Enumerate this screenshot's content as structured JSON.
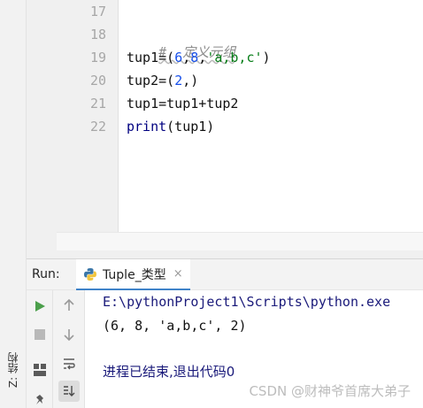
{
  "editor": {
    "line_numbers": [
      "17",
      "18",
      "19",
      "20",
      "21",
      "22"
    ],
    "code": {
      "comment": "#  定义元组",
      "line19_a": "tup1=(",
      "line19_n1": "6",
      "line19_c1": ",",
      "line19_n2": "8",
      "line19_c2": ",",
      "line19_s": "'a,b,c'",
      "line19_end": ")",
      "line20_a": "tup2=(",
      "line20_n": "2",
      "line20_end": ",)",
      "line21": "tup1=tup1+tup2",
      "line22_fn": "print",
      "line22_rest": "(tup1)"
    }
  },
  "run_panel": {
    "run_label": "Run:",
    "tab_label": "Tuple_类型",
    "tab_close": "×",
    "output": {
      "path": "E:\\pythonProject1\\Scripts\\python.exe",
      "result": "(6, 8, 'a,b,c', 2)",
      "exit": "进程已结束,退出代码0"
    }
  },
  "tool_strip": {
    "structure_label": "Z: 结构"
  },
  "watermark": "CSDN @财神爷首席大弟子",
  "icons": [
    "python-icon",
    "run-icon",
    "stop-icon",
    "layout-icon",
    "pin-icon",
    "up-arrow-icon",
    "down-arrow-icon",
    "soft-wrap-icon",
    "scroll-to-end-icon"
  ],
  "colors": {
    "run_green": "#4b9f4b",
    "tab_accent": "#4083c9",
    "string_green": "#067d17",
    "number_blue": "#1750eb"
  }
}
